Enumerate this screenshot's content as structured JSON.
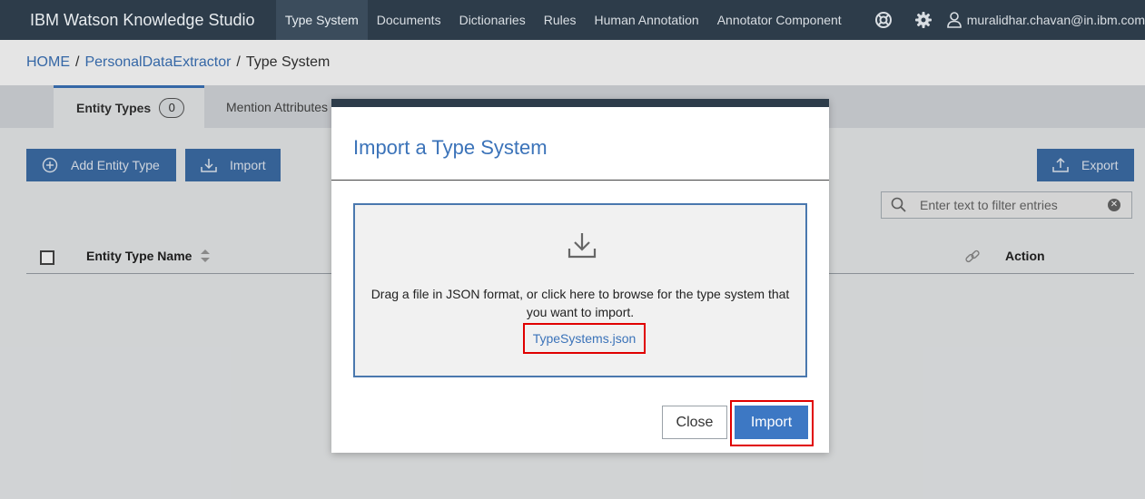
{
  "app": {
    "brand_prefix": "IBM",
    "brand_name": "Watson Knowledge Studio",
    "nav": [
      "Type System",
      "Documents",
      "Dictionaries",
      "Rules",
      "Human Annotation",
      "Annotator Component"
    ],
    "active_nav": "Type System",
    "user_email": "muralidhar.chavan@in.ibm.com",
    "icons": [
      "help-icon",
      "gear-icon",
      "user-icon"
    ]
  },
  "breadcrumb": {
    "home": "HOME",
    "sep1": "/",
    "project": "PersonalDataExtractor",
    "sep2": "/",
    "current": "Type System"
  },
  "tabs": {
    "entity_types_label": "Entity Types",
    "entity_types_count": "0",
    "mention_attributes_label": "Mention Attributes"
  },
  "toolbar": {
    "add_entity_type": "Add Entity Type",
    "import": "Import",
    "export": "Export",
    "filter_placeholder": "Enter text to filter entries"
  },
  "table": {
    "col_name": "Entity Type Name",
    "col_action": "Action"
  },
  "modal": {
    "title": "Import a Type System",
    "dropzone_text": "Drag a file in JSON format, or click here to browse for the type system that you want to import.",
    "file_name": "TypeSystems.json",
    "close_label": "Close",
    "import_label": "Import"
  },
  "colors": {
    "topbar": "#2d3c4a",
    "accent": "#3b73b9",
    "button": "#3d6ea8",
    "highlight": "#e00000"
  }
}
